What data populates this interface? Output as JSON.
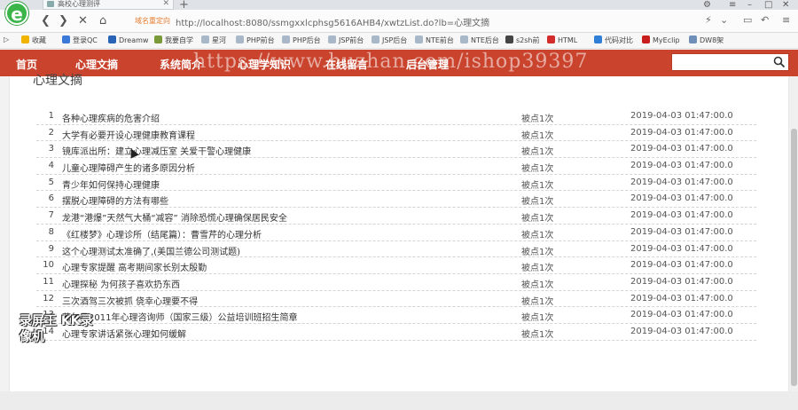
{
  "browser": {
    "tab_title": "高校心理测评",
    "back_icon": "back-arrow-icon",
    "forward_icon": "forward-arrow-icon",
    "reload_icon": "stop-icon",
    "home_icon": "home-icon",
    "hint": "域名重定向",
    "url": "http://localhost:8080/ssmgxxlcphsg5616AHB4/xwtzList.do?lb=心理文摘"
  },
  "bookmarks": [
    {
      "label": "收藏",
      "color": "#f0b400"
    },
    {
      "label": "登录QC",
      "color": "#3b79d8"
    },
    {
      "label": "Dreamw",
      "color": "#2a64b7"
    },
    {
      "label": "我要自学",
      "color": "#7a9a3a"
    },
    {
      "label": "星河",
      "color": "#a9b8c8"
    },
    {
      "label": "PHP前台",
      "color": "#a9b8c8"
    },
    {
      "label": "PHP后台",
      "color": "#a9b8c8"
    },
    {
      "label": "JSP前台",
      "color": "#a9b8c8"
    },
    {
      "label": "JSP后台",
      "color": "#a9b8c8"
    },
    {
      "label": "NTE前台",
      "color": "#a9b8c8"
    },
    {
      "label": "NTE后台",
      "color": "#a9b8c8"
    },
    {
      "label": "s2sh前",
      "color": "#444444"
    },
    {
      "label": "HTML",
      "color": "#d32a2a"
    },
    {
      "label": "代码对比",
      "color": "#2f7fd6"
    },
    {
      "label": "MyEclip",
      "color": "#c91e1e"
    },
    {
      "label": "DW8架",
      "color": "#6f8fb8"
    }
  ],
  "nav": {
    "items": [
      {
        "label": "首页"
      },
      {
        "label": "心理文摘"
      },
      {
        "label": "系统简介"
      },
      {
        "label": "心理学知识"
      },
      {
        "label": "在线留言"
      },
      {
        "label": "后台管理"
      }
    ],
    "search_placeholder": "",
    "watermark": "https://www.huzhan.com/ishop39397"
  },
  "section_title": "心理文摘",
  "articles": [
    {
      "num": "1",
      "title": "各种心理疾病的危害介绍",
      "clicks": "被点1次",
      "date": "2019-04-03 01:47:00.0"
    },
    {
      "num": "2",
      "title": "大学有必要开设心理健康教育课程",
      "clicks": "被点1次",
      "date": "2019-04-03 01:47:00.0"
    },
    {
      "num": "3",
      "title": "镜库派出所：建立心理减压室 关爱干警心理健康",
      "clicks": "被点1次",
      "date": "2019-04-03 01:47:00.0"
    },
    {
      "num": "4",
      "title": "儿童心理障碍产生的诸多原因分析",
      "clicks": "被点1次",
      "date": "2019-04-03 01:47:00.0"
    },
    {
      "num": "5",
      "title": "青少年如何保持心理健康",
      "clicks": "被点1次",
      "date": "2019-04-03 01:47:00.0"
    },
    {
      "num": "6",
      "title": "摆脱心理障碍的方法有哪些",
      "clicks": "被点1次",
      "date": "2019-04-03 01:47:00.0"
    },
    {
      "num": "7",
      "title": "龙港“港爆”天然气大桶“减容” 消除恐慌心理确保居民安全",
      "clicks": "被点1次",
      "date": "2019-04-03 01:47:00.0"
    },
    {
      "num": "8",
      "title": "《红楼梦》心理诊所（结尾篇）：曹雪芹的心理分析",
      "clicks": "被点1次",
      "date": "2019-04-03 01:47:00.0"
    },
    {
      "num": "9",
      "title": "这个心理测试太准确了,(美国兰德公司测试题)",
      "clicks": "被点1次",
      "date": "2019-04-03 01:47:00.0"
    },
    {
      "num": "10",
      "title": "心理专家提醒 高考期间家长别太殷勤",
      "clicks": "被点1次",
      "date": "2019-04-03 01:47:00.0"
    },
    {
      "num": "11",
      "title": "心理探秘 为何孩子喜欢扔东西",
      "clicks": "被点1次",
      "date": "2019-04-03 01:47:00.0"
    },
    {
      "num": "12",
      "title": "三次酒驾三次被抓 侥幸心理要不得",
      "clicks": "被点1次",
      "date": "2019-04-03 01:47:00.0"
    },
    {
      "num": "13",
      "title": "若尔县2011年心理咨询师（国家三级）公益培训班招生简章",
      "clicks": "被点1次",
      "date": "2019-04-03 01:47:00.0"
    },
    {
      "num": "14",
      "title": "心理专家讲话紧张心理如何缓解",
      "clicks": "被点1次",
      "date": "2019-04-03 01:47:00.0"
    }
  ],
  "overlay_logo": "录屏王 KK录像机"
}
